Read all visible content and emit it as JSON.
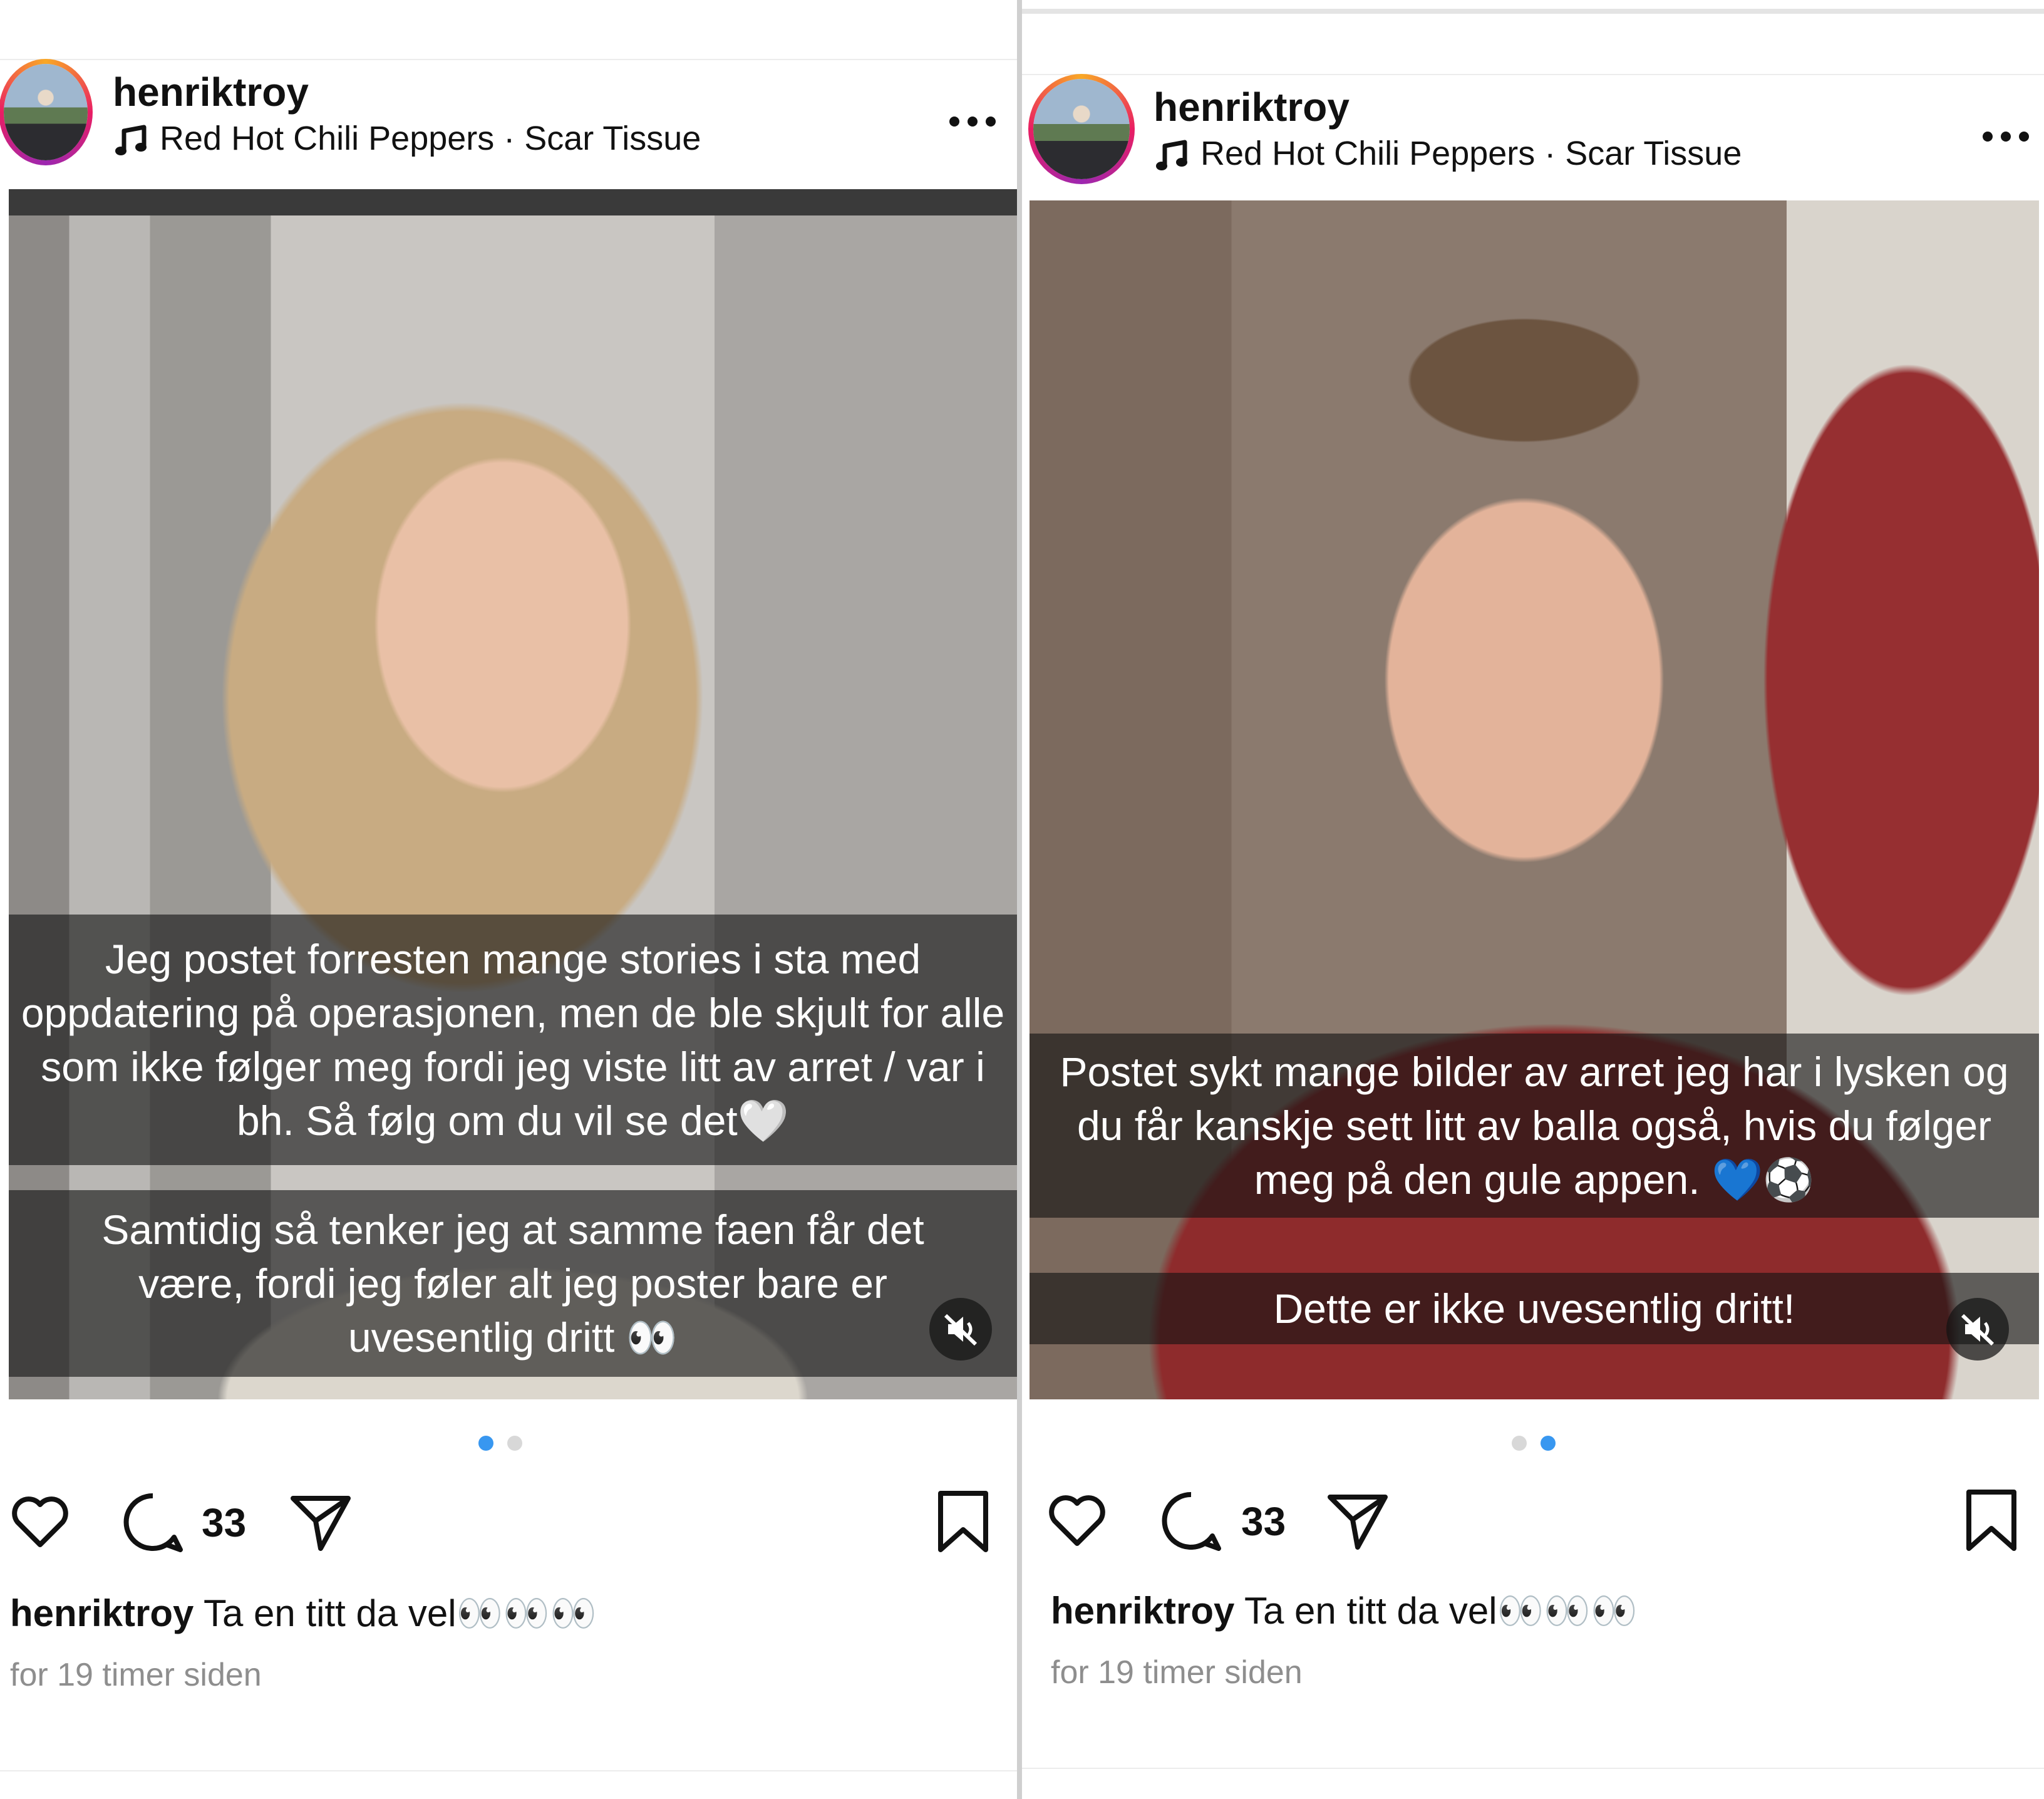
{
  "posts": [
    {
      "username": "henriktroy",
      "song": "Red Hot Chili Peppers · Scar Tissue",
      "captions": [
        "Jeg postet forresten mange stories i sta med oppdatering på operasjonen, men de ble skjult for alle som ikke følger meg fordi jeg viste litt av arret / var i bh. Så følg om du vil se det🤍",
        "Samtidig så tenker jeg at samme faen får det være, fordi jeg føler alt jeg poster bare er uvesentlig dritt 👀"
      ],
      "carousel_total": 2,
      "carousel_active": 1,
      "comment_count": "33",
      "caption_username": "henriktroy",
      "caption_text": "Ta en titt da vel👀👀👀",
      "timestamp": "for 19 timer siden"
    },
    {
      "username": "henriktroy",
      "song": "Red Hot Chili Peppers · Scar Tissue",
      "captions": [
        "Postet sykt mange bilder av arret jeg har i lysken og du får kanskje sett litt av balla også, hvis du følger meg på den gule appen. 💙⚽",
        "Dette er ikke uvesentlig dritt!"
      ],
      "carousel_total": 2,
      "carousel_active": 2,
      "comment_count": "33",
      "caption_username": "henriktroy",
      "caption_text": "Ta en titt da vel👀👀👀",
      "timestamp": "for 19 timer siden"
    }
  ],
  "icons": {
    "note": "music-note-icon",
    "more": "more-options-icon",
    "like": "heart-icon",
    "comment": "comment-icon",
    "share": "send-icon",
    "save": "bookmark-icon",
    "mute": "speaker-muted-icon"
  },
  "colors": {
    "active_dot": "#3897f0",
    "inactive_dot": "#d8d8d8",
    "timestamp": "#8e8e8e"
  }
}
